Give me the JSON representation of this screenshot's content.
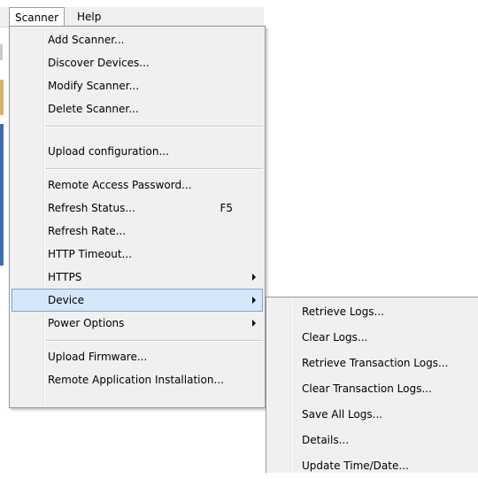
{
  "menubar": {
    "items": [
      {
        "label": "Scanner"
      },
      {
        "label": "Help"
      }
    ]
  },
  "scanner_menu": {
    "items": [
      {
        "label": "Add Scanner..."
      },
      {
        "label": "Discover Devices..."
      },
      {
        "label": "Modify Scanner..."
      },
      {
        "label": "Delete Scanner..."
      },
      {
        "label": "Upload configuration..."
      },
      {
        "label": "Remote Access Password..."
      },
      {
        "label": "Refresh Status...",
        "shortcut": "F5"
      },
      {
        "label": "Refresh Rate..."
      },
      {
        "label": "HTTP Timeout..."
      },
      {
        "label": "HTTPS"
      },
      {
        "label": "Device"
      },
      {
        "label": "Power Options"
      },
      {
        "label": "Upload Firmware..."
      },
      {
        "label": "Remote Application Installation..."
      }
    ]
  },
  "device_submenu": {
    "items": [
      {
        "label": "Retrieve Logs..."
      },
      {
        "label": "Clear Logs..."
      },
      {
        "label": "Retrieve Transaction Logs..."
      },
      {
        "label": "Clear Transaction Logs..."
      },
      {
        "label": "Save All Logs..."
      },
      {
        "label": "Details..."
      },
      {
        "label": "Update Time/Date..."
      }
    ]
  },
  "colors": {
    "menu_bg": "#f0f0f0",
    "highlight_bg": "#d5e7f8",
    "highlight_border": "#7da2ce"
  }
}
